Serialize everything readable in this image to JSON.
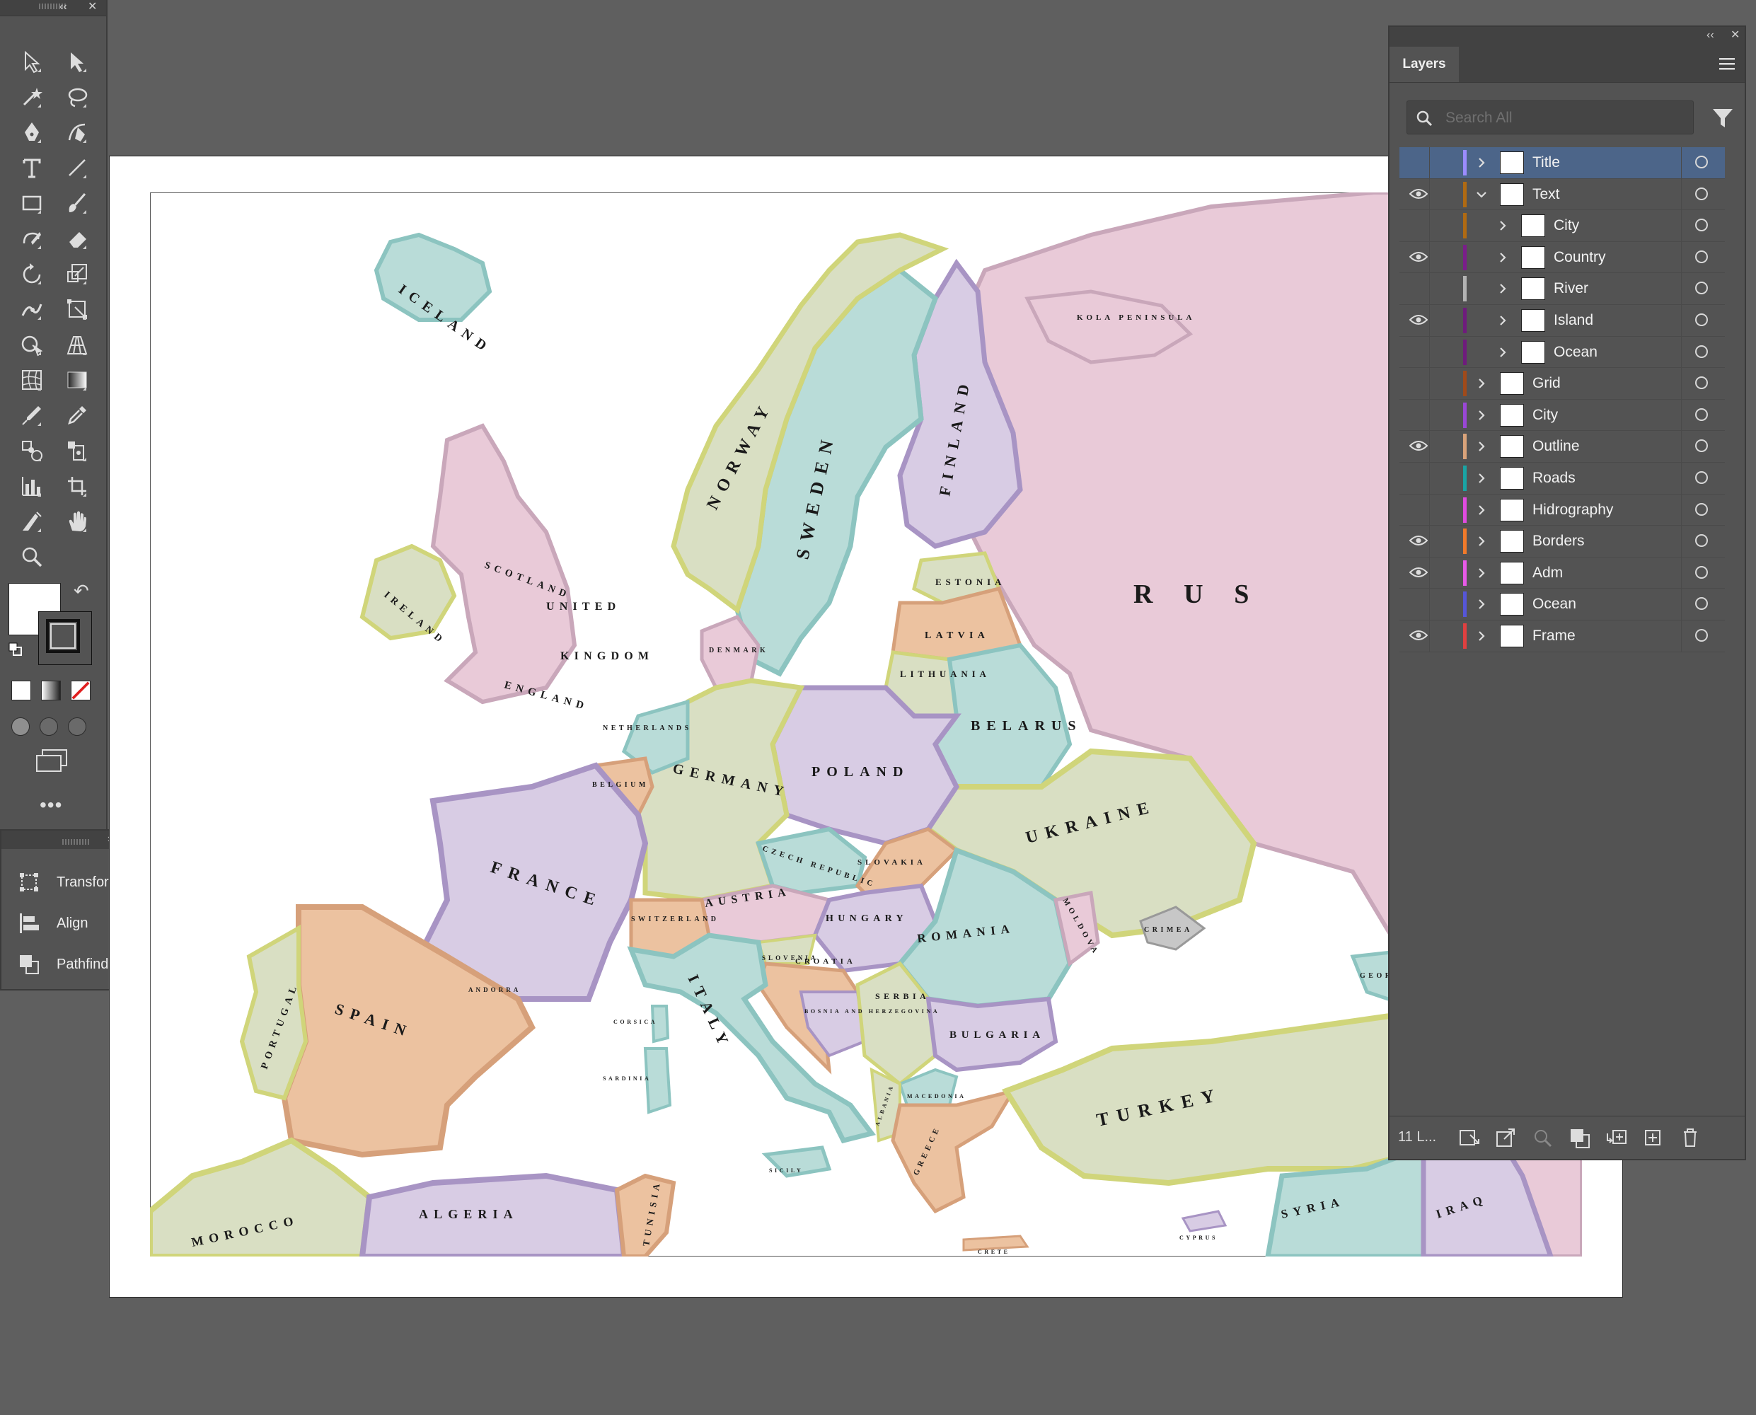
{
  "tools_panel": {
    "tools": [
      "selection-tool-icon",
      "direct-selection-tool-icon",
      "magic-wand-tool-icon",
      "lasso-tool-icon",
      "pen-tool-icon",
      "curvature-tool-icon",
      "type-tool-icon",
      "line-segment-tool-icon",
      "rectangle-tool-icon",
      "paintbrush-tool-icon",
      "shaper-tool-icon",
      "eraser-tool-icon",
      "rotate-tool-icon",
      "scale-tool-icon",
      "width-tool-icon",
      "free-transform-tool-icon",
      "shape-builder-tool-icon",
      "perspective-grid-tool-icon",
      "mesh-tool-icon",
      "gradient-tool-icon",
      "eyedropper-measure-icon",
      "eyedropper-tool-icon",
      "blend-tool-icon",
      "symbol-sprayer-tool-icon",
      "column-graph-tool-icon",
      "artboard-tool-icon",
      "slice-tool-icon",
      "hand-tool-icon",
      "zoom-tool-icon",
      ""
    ],
    "fill_color": "#ffffff",
    "stroke_color": "#000000",
    "more_label": "•••"
  },
  "mini_panels": {
    "items": [
      {
        "label": "Transform",
        "icon": "transform-icon"
      },
      {
        "label": "Align",
        "icon": "align-icon"
      },
      {
        "label": "Pathfinder",
        "icon": "pathfinder-icon"
      }
    ]
  },
  "layers_panel": {
    "tab_label": "Layers",
    "search_placeholder": "Search All",
    "layer_count": "11 L...",
    "layers": [
      {
        "name": "Title",
        "color": "#9b8cff",
        "visible": false,
        "expanded": false,
        "level": 0,
        "selected": true
      },
      {
        "name": "Text",
        "color": "#b06a12",
        "visible": true,
        "expanded": true,
        "level": 0,
        "selected": false
      },
      {
        "name": "City",
        "color": "#b06a12",
        "visible": false,
        "expanded": false,
        "level": 1,
        "selected": false
      },
      {
        "name": "Country",
        "color": "#7a1e8a",
        "visible": true,
        "expanded": false,
        "level": 1,
        "selected": false
      },
      {
        "name": "River",
        "color": "#b3b3b3",
        "visible": false,
        "expanded": false,
        "level": 1,
        "selected": false
      },
      {
        "name": "Island",
        "color": "#6e1c7c",
        "visible": true,
        "expanded": false,
        "level": 1,
        "selected": false
      },
      {
        "name": "Ocean",
        "color": "#6e1c7c",
        "visible": false,
        "expanded": false,
        "level": 1,
        "selected": false
      },
      {
        "name": "Grid",
        "color": "#a04a1a",
        "visible": false,
        "expanded": false,
        "level": 0,
        "selected": false
      },
      {
        "name": "City",
        "color": "#9a47d6",
        "visible": false,
        "expanded": false,
        "level": 0,
        "selected": false
      },
      {
        "name": "Outline",
        "color": "#d9a37a",
        "visible": true,
        "expanded": false,
        "level": 0,
        "selected": false
      },
      {
        "name": "Roads",
        "color": "#1aa4a4",
        "visible": false,
        "expanded": false,
        "level": 0,
        "selected": false
      },
      {
        "name": "Hidrography",
        "color": "#e04be0",
        "visible": false,
        "expanded": false,
        "level": 0,
        "selected": false
      },
      {
        "name": "Borders",
        "color": "#f07a2a",
        "visible": true,
        "expanded": false,
        "level": 0,
        "selected": false
      },
      {
        "name": "Adm",
        "color": "#e85ae8",
        "visible": true,
        "expanded": false,
        "level": 0,
        "selected": false
      },
      {
        "name": "Ocean",
        "color": "#5656d8",
        "visible": false,
        "expanded": false,
        "level": 0,
        "selected": false
      },
      {
        "name": "Frame",
        "color": "#e04040",
        "visible": true,
        "expanded": false,
        "level": 0,
        "selected": false
      }
    ]
  },
  "map": {
    "labels": [
      {
        "text": "ICELAND"
      },
      {
        "text": "NORWAY"
      },
      {
        "text": "SWEDEN"
      },
      {
        "text": "FINLAND"
      },
      {
        "text": "KOLA PENINSULA"
      },
      {
        "text": "R U S"
      },
      {
        "text": "ESTONIA"
      },
      {
        "text": "LATVIA"
      },
      {
        "text": "LITHUANIA"
      },
      {
        "text": "BELARUS"
      },
      {
        "text": "SCOTLAND"
      },
      {
        "text": "UNITED"
      },
      {
        "text": "KINGDOM"
      },
      {
        "text": "IRELAND"
      },
      {
        "text": "ENGLAND"
      },
      {
        "text": "DENMARK"
      },
      {
        "text": "NETHERLANDS"
      },
      {
        "text": "BELGIUM"
      },
      {
        "text": "GERMANY"
      },
      {
        "text": "POLAND"
      },
      {
        "text": "CZECH REPUBLIC"
      },
      {
        "text": "SLOVAKIA"
      },
      {
        "text": "UKRAINE"
      },
      {
        "text": "FRANCE"
      },
      {
        "text": "AUSTRIA"
      },
      {
        "text": "HUNGARY"
      },
      {
        "text": "SWITZERLAND"
      },
      {
        "text": "ROMANIA"
      },
      {
        "text": "MOLDOVA"
      },
      {
        "text": "CRIMEA"
      },
      {
        "text": "SLOVENIA"
      },
      {
        "text": "CROATIA"
      },
      {
        "text": "SERBIA"
      },
      {
        "text": "BOSNIA AND HERZEGOVINA"
      },
      {
        "text": "BULGARIA"
      },
      {
        "text": "ITALY"
      },
      {
        "text": "SPAIN"
      },
      {
        "text": "PORTUGAL"
      },
      {
        "text": "ANDORRA"
      },
      {
        "text": "MACEDONIA"
      },
      {
        "text": "GREECE"
      },
      {
        "text": "ALBANIA"
      },
      {
        "text": "TURKEY"
      },
      {
        "text": "GEORGIA"
      },
      {
        "text": "MOROCCO"
      },
      {
        "text": "ALGERIA"
      },
      {
        "text": "TUNISIA"
      },
      {
        "text": "SYRIA"
      },
      {
        "text": "IRAQ"
      },
      {
        "text": "SICILY"
      },
      {
        "text": "CORSICA"
      },
      {
        "text": "SARDINIA"
      },
      {
        "text": "CRETE"
      },
      {
        "text": "CYPRUS"
      }
    ],
    "colors": {
      "pink": "#e9cad8",
      "green": "#d9dfc3",
      "teal": "#b9dcd8",
      "lavender": "#d8cce4",
      "orange": "#ecc2a0",
      "border_yellow": "#d0d57a",
      "border_purple": "#a894c4",
      "border_teal": "#8cc4c0"
    }
  }
}
